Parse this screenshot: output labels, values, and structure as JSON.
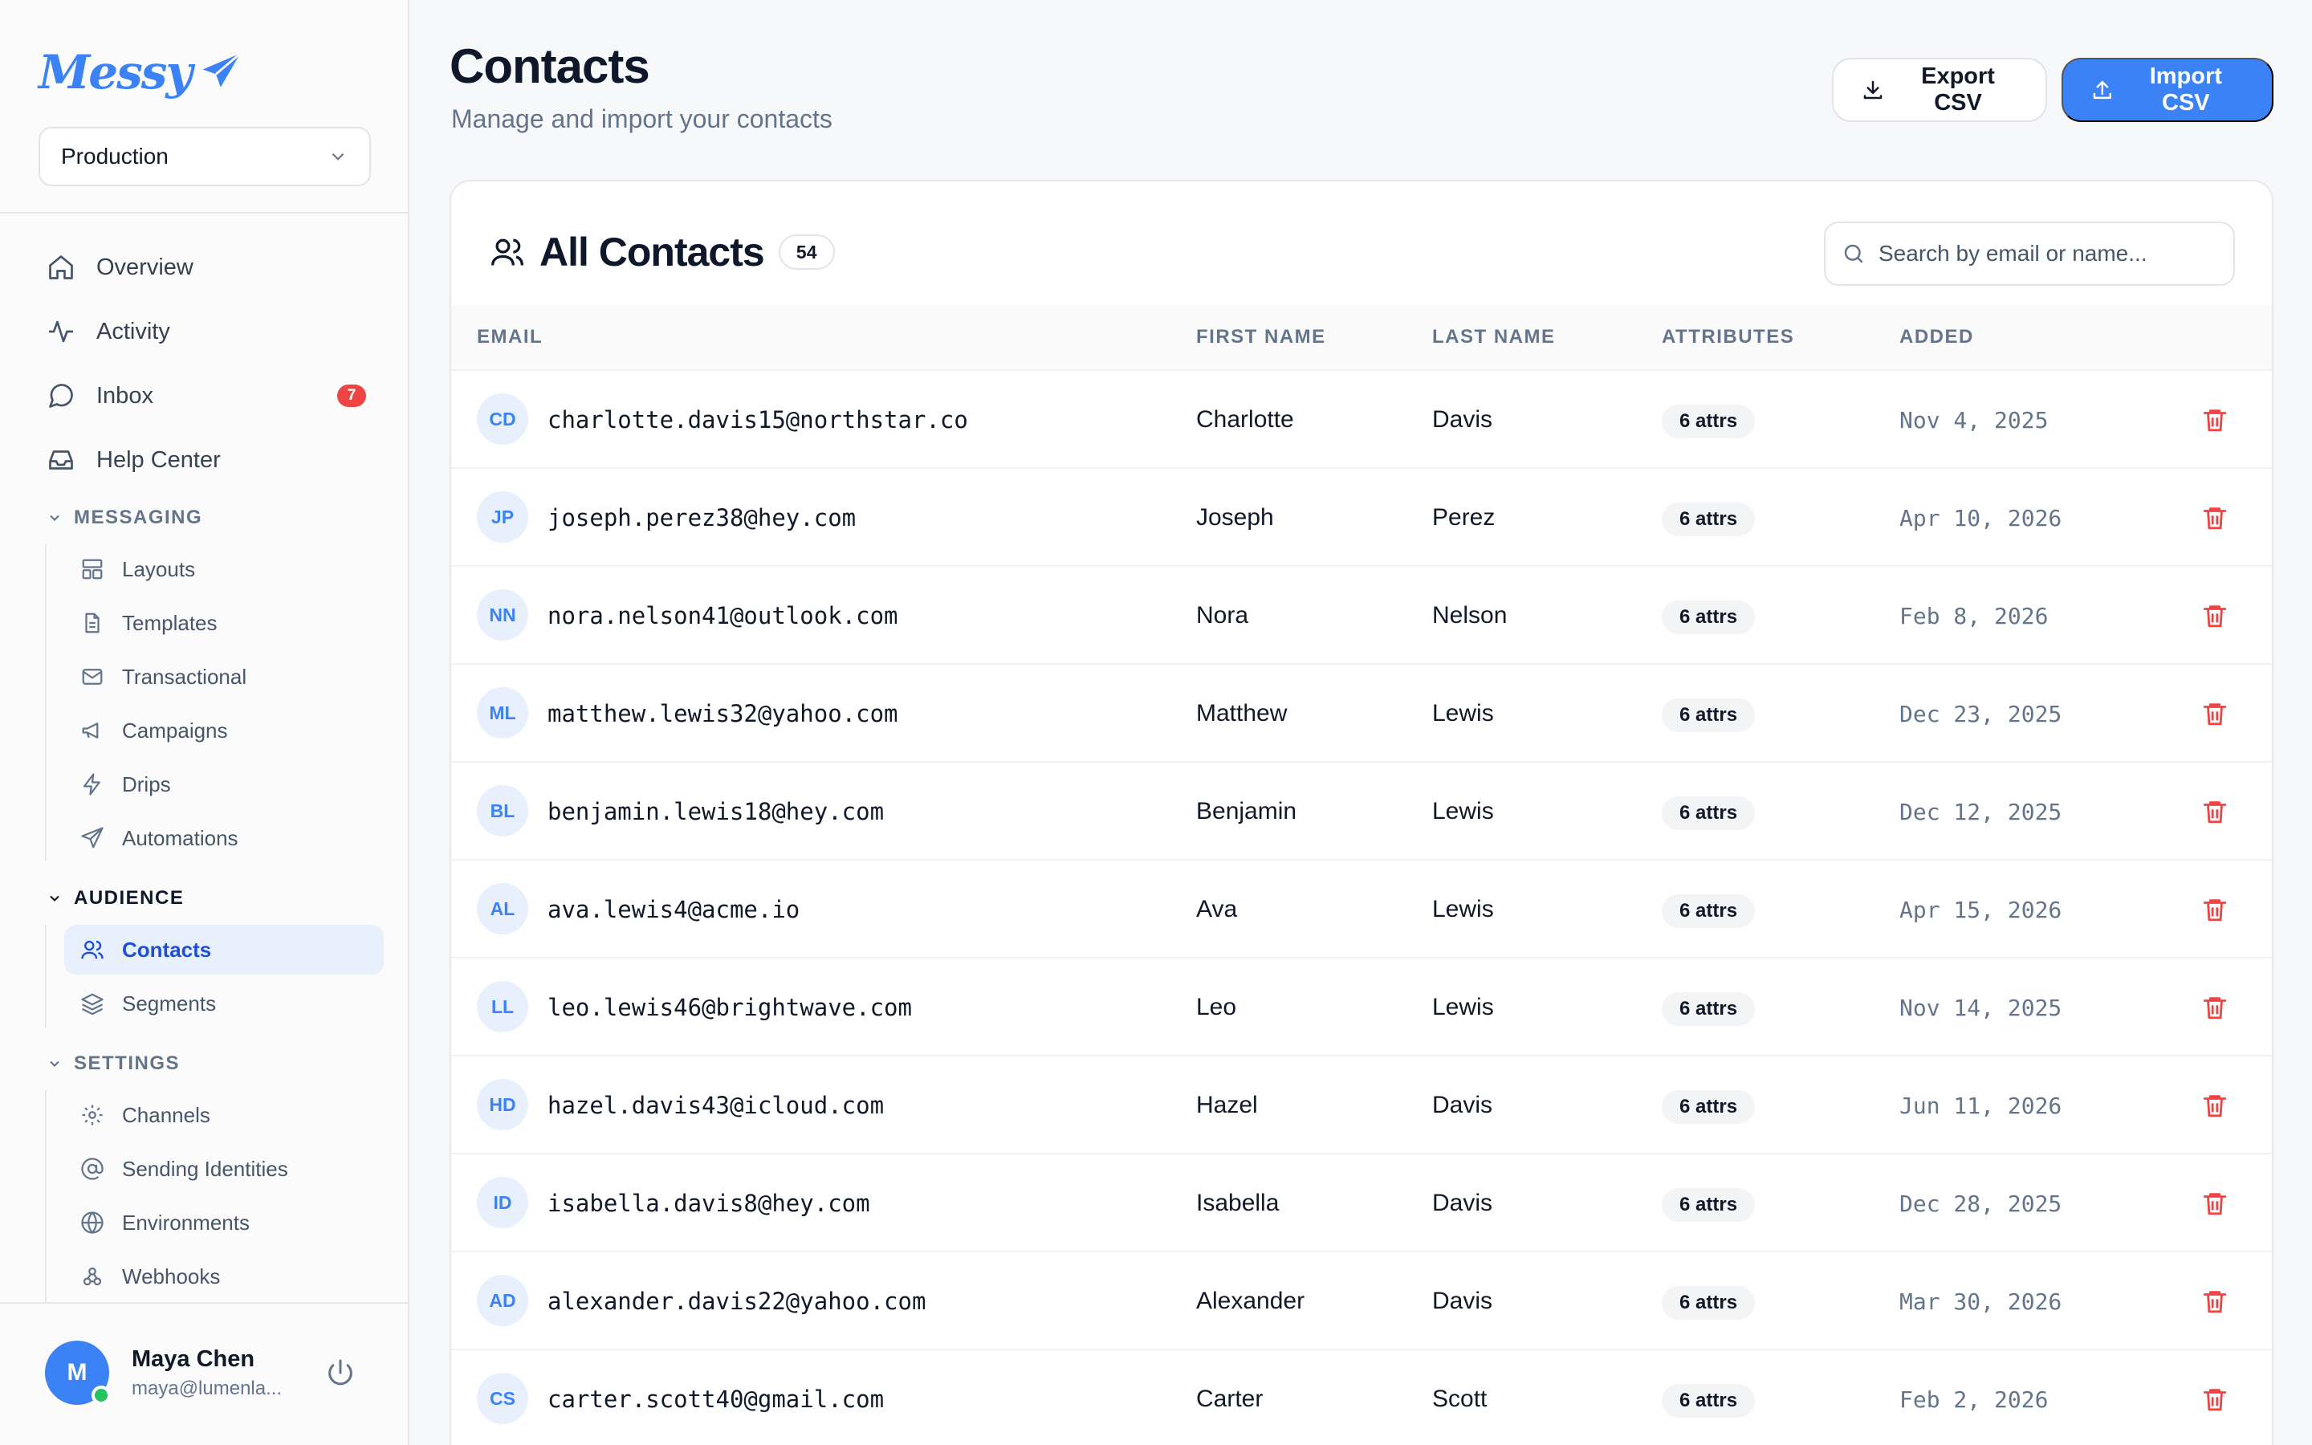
{
  "sidebar": {
    "logo_text": "Messy",
    "environment": "Production",
    "nav": [
      {
        "label": "Overview"
      },
      {
        "label": "Activity"
      },
      {
        "label": "Inbox",
        "badge": "7"
      },
      {
        "label": "Help Center"
      }
    ],
    "sections": {
      "messaging": {
        "title": "MESSAGING",
        "items": [
          "Layouts",
          "Templates",
          "Transactional",
          "Campaigns",
          "Drips",
          "Automations"
        ]
      },
      "audience": {
        "title": "AUDIENCE",
        "items": [
          "Contacts",
          "Segments"
        ]
      },
      "settings": {
        "title": "SETTINGS",
        "items": [
          "Channels",
          "Sending Identities",
          "Environments",
          "Webhooks"
        ]
      }
    },
    "user": {
      "initial": "M",
      "name": "Maya Chen",
      "email": "maya@lumenla..."
    }
  },
  "header": {
    "title": "Contacts",
    "subtitle": "Manage and import your contacts",
    "export_label": "Export CSV",
    "import_label": "Import CSV"
  },
  "card": {
    "title": "All Contacts",
    "count": "54",
    "search_placeholder": "Search by email or name..."
  },
  "table": {
    "columns": [
      "EMAIL",
      "FIRST NAME",
      "LAST NAME",
      "ATTRIBUTES",
      "ADDED"
    ],
    "rows": [
      {
        "initials": "CD",
        "email": "charlotte.davis15@northstar.co",
        "first": "Charlotte",
        "last": "Davis",
        "attrs": "6 attrs",
        "added": "Nov 4, 2025"
      },
      {
        "initials": "JP",
        "email": "joseph.perez38@hey.com",
        "first": "Joseph",
        "last": "Perez",
        "attrs": "6 attrs",
        "added": "Apr 10, 2026"
      },
      {
        "initials": "NN",
        "email": "nora.nelson41@outlook.com",
        "first": "Nora",
        "last": "Nelson",
        "attrs": "6 attrs",
        "added": "Feb 8, 2026"
      },
      {
        "initials": "ML",
        "email": "matthew.lewis32@yahoo.com",
        "first": "Matthew",
        "last": "Lewis",
        "attrs": "6 attrs",
        "added": "Dec 23, 2025"
      },
      {
        "initials": "BL",
        "email": "benjamin.lewis18@hey.com",
        "first": "Benjamin",
        "last": "Lewis",
        "attrs": "6 attrs",
        "added": "Dec 12, 2025"
      },
      {
        "initials": "AL",
        "email": "ava.lewis4@acme.io",
        "first": "Ava",
        "last": "Lewis",
        "attrs": "6 attrs",
        "added": "Apr 15, 2026"
      },
      {
        "initials": "LL",
        "email": "leo.lewis46@brightwave.com",
        "first": "Leo",
        "last": "Lewis",
        "attrs": "6 attrs",
        "added": "Nov 14, 2025"
      },
      {
        "initials": "HD",
        "email": "hazel.davis43@icloud.com",
        "first": "Hazel",
        "last": "Davis",
        "attrs": "6 attrs",
        "added": "Jun 11, 2026"
      },
      {
        "initials": "ID",
        "email": "isabella.davis8@hey.com",
        "first": "Isabella",
        "last": "Davis",
        "attrs": "6 attrs",
        "added": "Dec 28, 2025"
      },
      {
        "initials": "AD",
        "email": "alexander.davis22@yahoo.com",
        "first": "Alexander",
        "last": "Davis",
        "attrs": "6 attrs",
        "added": "Mar 30, 2026"
      },
      {
        "initials": "CS",
        "email": "carter.scott40@gmail.com",
        "first": "Carter",
        "last": "Scott",
        "attrs": "6 attrs",
        "added": "Feb 2, 2026"
      }
    ]
  },
  "colors": {
    "accent": "#3b82f6",
    "danger": "#ef4444",
    "online": "#22c55e"
  }
}
